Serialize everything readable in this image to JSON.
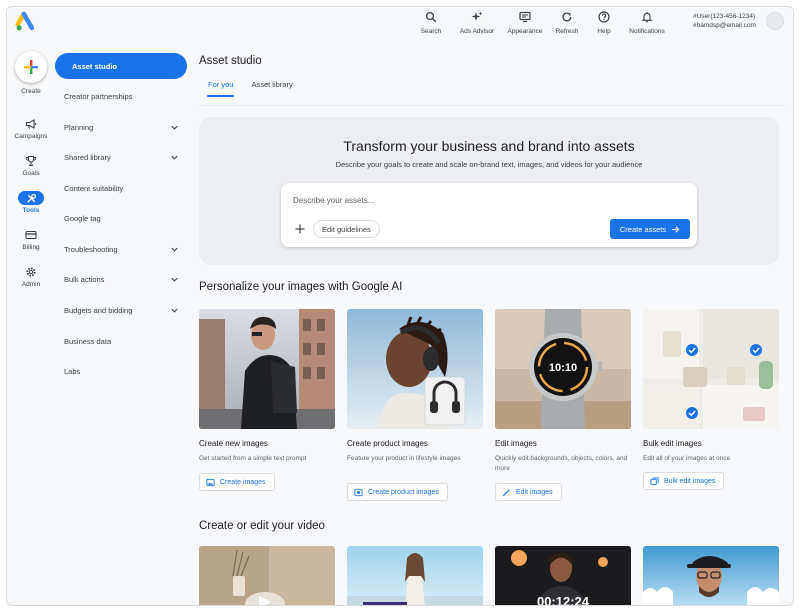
{
  "header": {
    "actions": [
      {
        "label": "Search",
        "icon": "search-icon"
      },
      {
        "label": "Ads Advisor",
        "icon": "sparkle-icon"
      },
      {
        "label": "Appearance",
        "icon": "appearance-icon"
      },
      {
        "label": "Refresh",
        "icon": "refresh-icon"
      },
      {
        "label": "Help",
        "icon": "help-icon"
      },
      {
        "label": "Notifications",
        "icon": "bell-icon"
      }
    ],
    "account_id": "#User(123-456-1234)",
    "account_email": "#bamdsp@email.com"
  },
  "rail": {
    "create_label": "Create",
    "items": [
      {
        "label": "Campaigns",
        "icon": "megaphone-icon"
      },
      {
        "label": "Goals",
        "icon": "trophy-icon"
      },
      {
        "label": "Tools",
        "icon": "tools-icon"
      },
      {
        "label": "Billing",
        "icon": "card-icon"
      },
      {
        "label": "Admin",
        "icon": "gear-icon"
      }
    ]
  },
  "nav": {
    "items": [
      {
        "label": "Asset studio"
      },
      {
        "label": "Creator partnerships"
      },
      {
        "label": "Planning"
      },
      {
        "label": "Shared library"
      },
      {
        "label": "Content suitability"
      },
      {
        "label": "Google tag"
      },
      {
        "label": "Troubleshooting"
      },
      {
        "label": "Bulk actions"
      },
      {
        "label": "Budgets and bidding"
      },
      {
        "label": "Business data"
      },
      {
        "label": "Labs"
      }
    ]
  },
  "main": {
    "title": "Asset studio",
    "tabs": [
      {
        "label": "For you"
      },
      {
        "label": "Asset library"
      }
    ],
    "hero": {
      "title": "Transform your business and brand into assets",
      "subtitle": "Describe your goals to create and scale on-brand text, images, and videos for your audience",
      "placeholder": "Describe your assets...",
      "guidelines_label": "Edit guidelines",
      "create_label": "Create assets"
    },
    "images_section": {
      "title": "Personalize your images with Google AI",
      "cards": [
        {
          "title": "Create new images",
          "desc": "Get started from a simple text prompt",
          "button": "Create images"
        },
        {
          "title": "Create product images",
          "desc": "Feature your product in lifestyle images",
          "button": "Create product images"
        },
        {
          "title": "Edit images",
          "desc": "Quickly edit backgrounds, objects, colors, and more",
          "button": "Edit images"
        },
        {
          "title": "Bulk edit images",
          "desc": "Edit all of your images at once",
          "button": "Bulk edit images"
        }
      ],
      "watch_time": "10:10"
    },
    "video_section": {
      "title": "Create or edit your video",
      "timer": "00:12:24"
    }
  },
  "colors": {
    "accent": "#1a73e8",
    "panel": "#eceef1",
    "background": "#f8f9fa"
  }
}
